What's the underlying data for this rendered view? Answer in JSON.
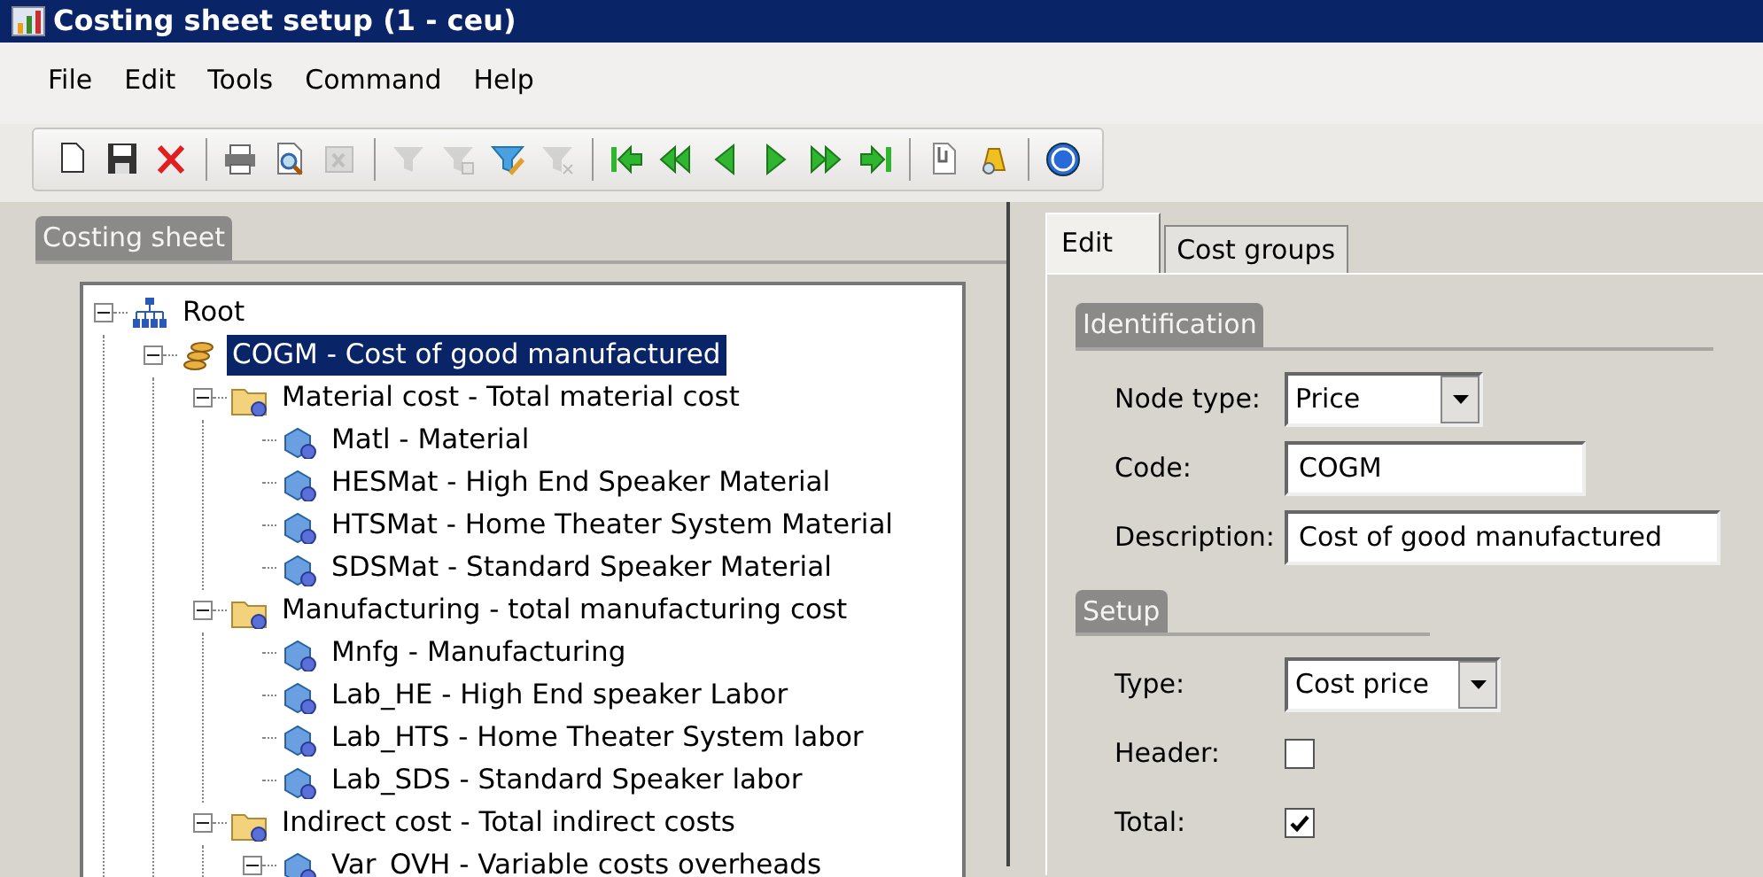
{
  "window": {
    "title": "Costing sheet setup (1 - ceu)"
  },
  "menu": [
    "File",
    "Edit",
    "Tools",
    "Command",
    "Help"
  ],
  "toolbar": {
    "groups": [
      [
        {
          "disabled": false
        },
        {
          "disabled": false
        },
        {
          "disabled": false
        }
      ],
      [
        {
          "disabled": false
        },
        {
          "disabled": false
        },
        {
          "disabled": true
        }
      ],
      [
        {
          "disabled": true
        },
        {
          "disabled": true
        },
        {
          "disabled": false
        },
        {
          "disabled": true
        }
      ],
      [
        {
          "disabled": false
        },
        {
          "disabled": false
        },
        {
          "disabled": false
        },
        {
          "disabled": false
        },
        {
          "disabled": false
        },
        {
          "disabled": false
        }
      ],
      [
        {
          "disabled": false
        },
        {
          "disabled": false
        }
      ],
      [
        {
          "disabled": false
        }
      ]
    ]
  },
  "tree_panel": {
    "title": "Costing sheet",
    "nodes": [
      {
        "kind": "root",
        "label": "Root",
        "expanded": true,
        "selected": false,
        "children": [
          {
            "kind": "coins",
            "label": "COGM - Cost of good manufactured",
            "expanded": true,
            "selected": true,
            "children": [
              {
                "kind": "folder",
                "label": "Material cost - Total material cost",
                "expanded": true,
                "selected": false,
                "children": [
                  {
                    "kind": "item",
                    "label": "Matl - Material",
                    "selected": false
                  },
                  {
                    "kind": "item",
                    "label": "HESMat - High End Speaker Material",
                    "selected": false
                  },
                  {
                    "kind": "item",
                    "label": "HTSMat - Home Theater System  Material",
                    "selected": false
                  },
                  {
                    "kind": "item",
                    "label": "SDSMat - Standard Speaker Material",
                    "selected": false
                  }
                ]
              },
              {
                "kind": "folder",
                "label": "Manufacturing - total manufacturing cost",
                "expanded": true,
                "selected": false,
                "children": [
                  {
                    "kind": "item",
                    "label": "Mnfg - Manufacturing",
                    "selected": false
                  },
                  {
                    "kind": "item",
                    "label": "Lab_HE - High End speaker Labor",
                    "selected": false
                  },
                  {
                    "kind": "item",
                    "label": "Lab_HTS - Home Theater System labor",
                    "selected": false
                  },
                  {
                    "kind": "item",
                    "label": "Lab_SDS - Standard Speaker labor",
                    "selected": false
                  }
                ]
              },
              {
                "kind": "folder",
                "label": "Indirect cost - Total indirect costs",
                "expanded": true,
                "selected": false,
                "children": [
                  {
                    "kind": "item",
                    "label": "Var_OVH - Variable costs overheads",
                    "expanded": true,
                    "selected": false
                  }
                ]
              }
            ]
          }
        ]
      }
    ]
  },
  "tabs": [
    {
      "label": "Edit",
      "selected": true
    },
    {
      "label": "Cost groups",
      "selected": false
    }
  ],
  "sections": [
    {
      "title": "Identification",
      "fields": [
        {
          "kind": "select",
          "label": "Node type:",
          "value": "Price"
        },
        {
          "kind": "text",
          "label": "Code:",
          "value": "COGM"
        },
        {
          "kind": "text",
          "label": "Description:",
          "value": "Cost of good manufactured"
        }
      ]
    },
    {
      "title": "Setup",
      "fields": [
        {
          "kind": "select",
          "label": "Type:",
          "value": "Cost price"
        },
        {
          "kind": "checkbox",
          "label": "Header:",
          "checked": false
        },
        {
          "kind": "checkbox",
          "label": "Total:",
          "checked": true
        }
      ]
    }
  ]
}
